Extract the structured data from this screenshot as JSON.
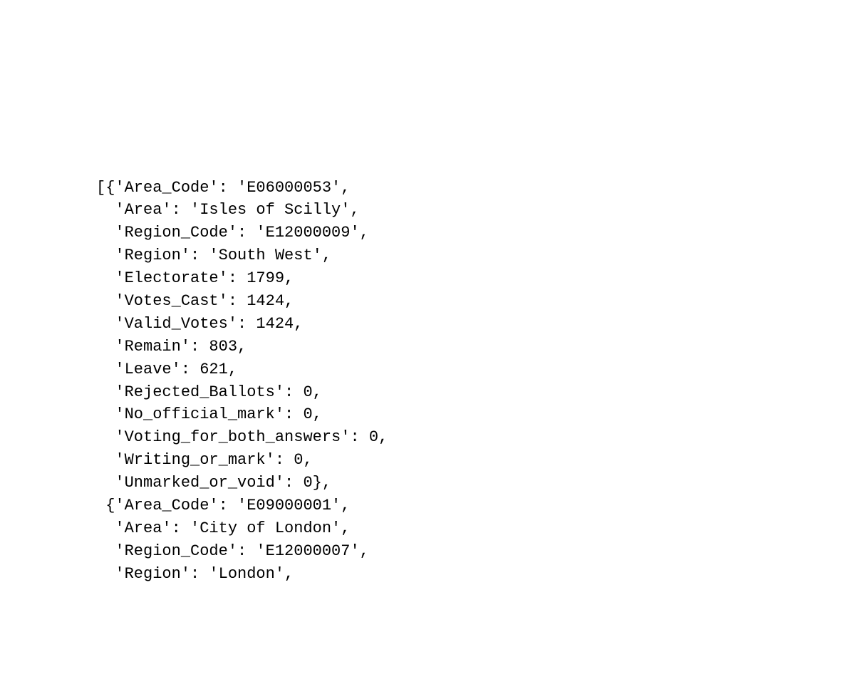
{
  "records": [
    {
      "Area_Code": "E06000053",
      "Area": "Isles of Scilly",
      "Region_Code": "E12000009",
      "Region": "South West",
      "Electorate": 1799,
      "Votes_Cast": 1424,
      "Valid_Votes": 1424,
      "Remain": 803,
      "Leave": 621,
      "Rejected_Ballots": 0,
      "No_official_mark": 0,
      "Voting_for_both_answers": 0,
      "Writing_or_mark": 0,
      "Unmarked_or_void": 0
    },
    {
      "Area_Code": "E09000001",
      "Area": "City of London",
      "Region_Code": "E12000007",
      "Region": "London"
    }
  ],
  "lines": {
    "l0": "[{'Area_Code': 'E06000053',",
    "l1": "  'Area': 'Isles of Scilly',",
    "l2": "  'Region_Code': 'E12000009',",
    "l3": "  'Region': 'South West',",
    "l4": "  'Electorate': 1799,",
    "l5": "  'Votes_Cast': 1424,",
    "l6": "  'Valid_Votes': 1424,",
    "l7": "  'Remain': 803,",
    "l8": "  'Leave': 621,",
    "l9": "  'Rejected_Ballots': 0,",
    "l10": "  'No_official_mark': 0,",
    "l11": "  'Voting_for_both_answers': 0,",
    "l12": "  'Writing_or_mark': 0,",
    "l13": "  'Unmarked_or_void': 0},",
    "l14": " {'Area_Code': 'E09000001',",
    "l15": "  'Area': 'City of London',",
    "l16": "  'Region_Code': 'E12000007',",
    "l17": "  'Region': 'London',"
  }
}
